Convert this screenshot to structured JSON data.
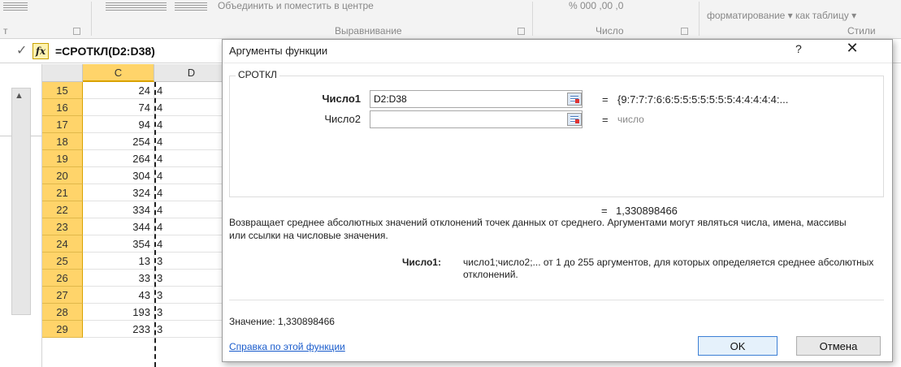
{
  "ribbon": {
    "cut_left": "т",
    "alignment_top": "Объединить и поместить в центре",
    "number_top": "% 000 ,00 ,0",
    "styles_top": "форматирование ▾ как таблицу ▾",
    "group_alignment": "Выравнивание",
    "group_number": "Число",
    "group_styles": "Стили"
  },
  "formula_bar": {
    "check_glyph": "✓",
    "fx_glyph": "fx",
    "formula": "=СРОТКЛ(D2:D38)"
  },
  "grid": {
    "columns": [
      "C",
      "D"
    ],
    "rows": [
      {
        "row": "15",
        "c": "24",
        "d": "4"
      },
      {
        "row": "16",
        "c": "74",
        "d": "4"
      },
      {
        "row": "17",
        "c": "94",
        "d": "4"
      },
      {
        "row": "18",
        "c": "254",
        "d": "4"
      },
      {
        "row": "19",
        "c": "264",
        "d": "4"
      },
      {
        "row": "20",
        "c": "304",
        "d": "4"
      },
      {
        "row": "21",
        "c": "324",
        "d": "4"
      },
      {
        "row": "22",
        "c": "334",
        "d": "4"
      },
      {
        "row": "23",
        "c": "344",
        "d": "4"
      },
      {
        "row": "24",
        "c": "354",
        "d": "4"
      },
      {
        "row": "25",
        "c": "13",
        "d": "3"
      },
      {
        "row": "26",
        "c": "33",
        "d": "3"
      },
      {
        "row": "27",
        "c": "43",
        "d": "3"
      },
      {
        "row": "28",
        "c": "193",
        "d": "3"
      },
      {
        "row": "29",
        "c": "233",
        "d": "3"
      }
    ]
  },
  "dialog": {
    "title": "Аргументы функции",
    "help_glyph": "?",
    "close_glyph": "✕",
    "function_name": "СРОТКЛ",
    "arg1_label": "Число1",
    "arg1_value": "D2:D38",
    "arg1_eq": "=",
    "arg1_result": "{9:7:7:7:6:6:5:5:5:5:5:5:5:4:4:4:4:4:...",
    "arg2_label": "Число2",
    "arg2_value": "",
    "arg2_eq": "=",
    "arg2_result": "число",
    "result_eq": "=",
    "result_value": "1,330898466",
    "description": "Возвращает среднее абсолютных значений отклонений точек данных от среднего. Аргументами могут являться числа, имена, массивы или ссылки на числовые значения.",
    "arg1_help_label": "Число1:",
    "arg1_help": "число1;число2;... от 1 до 255 аргументов, для которых определяется среднее абсолютных отклонений.",
    "value_line": "Значение:  1,330898466",
    "help_link": "Справка по этой функции",
    "ok_label": "OK",
    "cancel_label": "Отмена"
  }
}
